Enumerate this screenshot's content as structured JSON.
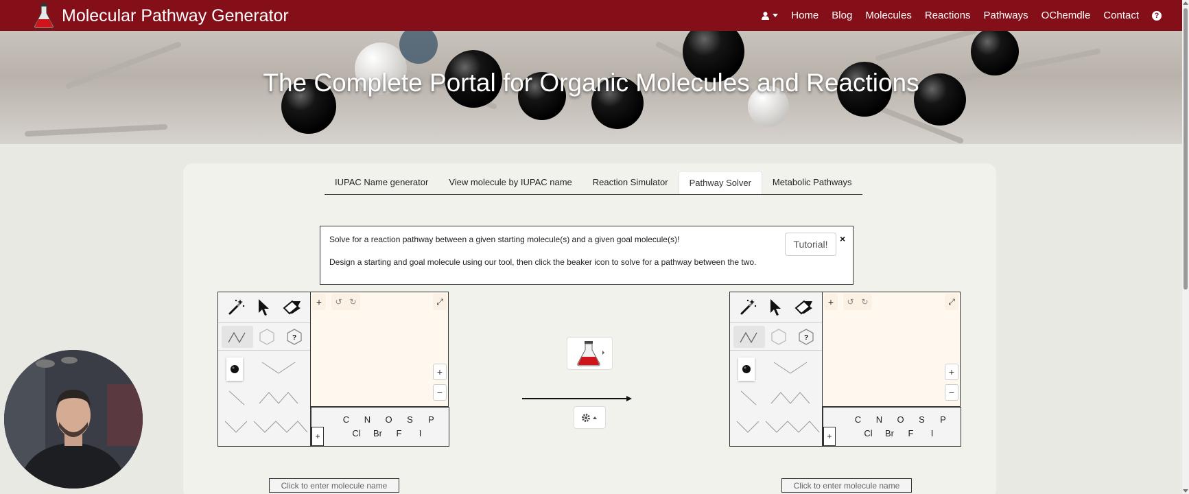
{
  "navbar": {
    "brand": "Molecular Pathway Generator",
    "brand_color": "#850f19",
    "links": [
      "Home",
      "Blog",
      "Molecules",
      "Reactions",
      "Pathways",
      "OChemdle",
      "Contact"
    ],
    "user_icon": "user-icon",
    "help_icon": "question-circle-icon"
  },
  "hero": {
    "title": "The Complete Portal for Organic Molecules and Reactions"
  },
  "tabs": [
    {
      "label": "IUPAC Name generator",
      "active": false
    },
    {
      "label": "View molecule by IUPAC name",
      "active": false
    },
    {
      "label": "Reaction Simulator",
      "active": false
    },
    {
      "label": "Pathway Solver",
      "active": true
    },
    {
      "label": "Metabolic Pathways",
      "active": false
    }
  ],
  "info": {
    "line1": "Solve for a reaction pathway between a given starting molecule(s) and a given goal molecule(s)!",
    "line2": "Design a starting and goal molecule using our tool, then click the beaker icon to solve for a pathway between the two.",
    "tutorial_label": "Tutorial!",
    "close_label": "×"
  },
  "editor": {
    "elements_row1": [
      "C",
      "N",
      "O",
      "S",
      "P"
    ],
    "elements_row2": [
      "Cl",
      "Br",
      "F",
      "I"
    ],
    "unknown_ring_label": "?",
    "plus_label": "+",
    "minus_label": "−",
    "undo_label": "↺",
    "redo_label": "↻",
    "expand_label": "⤢"
  },
  "start_molecule": {
    "placeholder": "Click to enter molecule name"
  },
  "goal_molecule": {
    "placeholder": "Click to enter molecule name"
  },
  "controls": {
    "solve_icon": "beaker-icon",
    "settings_icon": "gear-icon"
  }
}
